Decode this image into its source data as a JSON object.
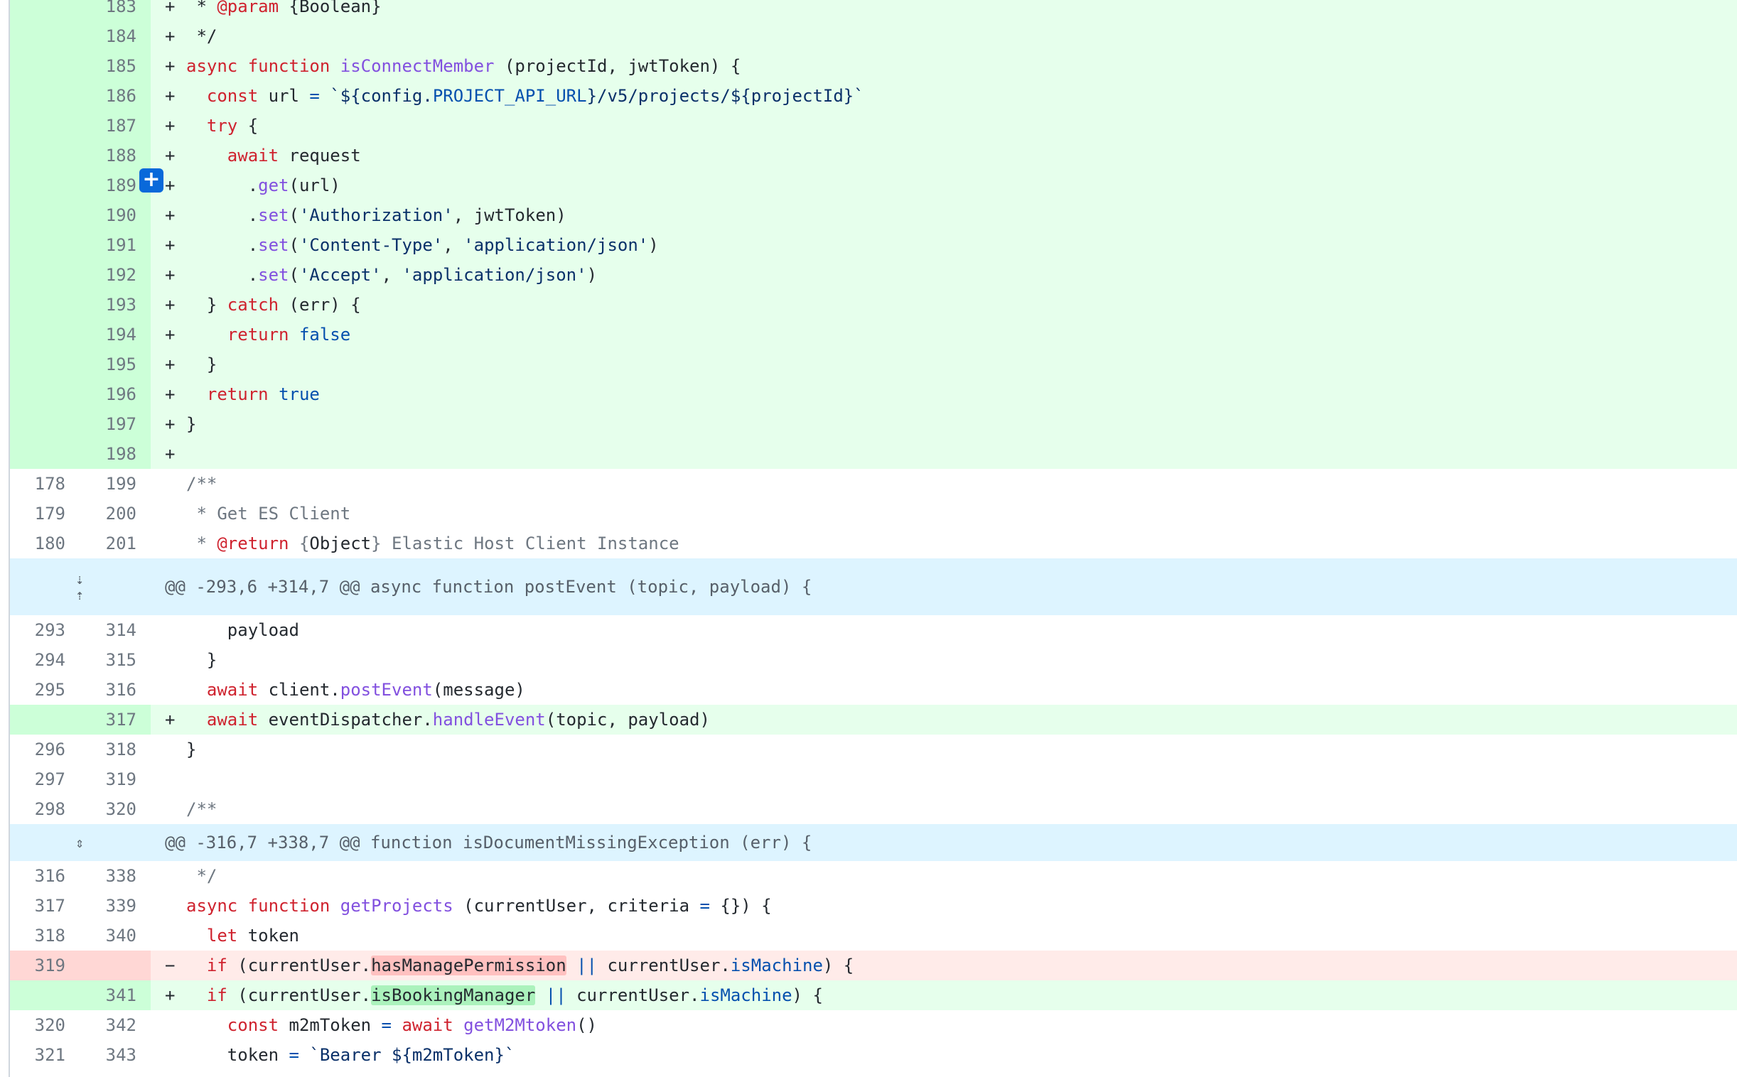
{
  "add_comment": {
    "label": "+"
  },
  "hunks": [
    {
      "header": "@@ -293,6 +314,7 @@ async function postEvent (topic, payload) {",
      "expand_up": "⇣",
      "expand_down": "⇡"
    },
    {
      "header": "@@ -316,7 +338,7 @@ function isDocumentMissingException (err) {",
      "expand_both": "⇕"
    }
  ],
  "lines": [
    {
      "old": "",
      "new": "183",
      "marker": "+",
      "type": "add"
    },
    {
      "old": "",
      "new": "184",
      "marker": "+",
      "type": "add"
    },
    {
      "old": "",
      "new": "185",
      "marker": "+",
      "type": "add"
    },
    {
      "old": "",
      "new": "186",
      "marker": "+",
      "type": "add"
    },
    {
      "old": "",
      "new": "187",
      "marker": "+",
      "type": "add"
    },
    {
      "old": "",
      "new": "188",
      "marker": "+",
      "type": "add"
    },
    {
      "old": "",
      "new": "189",
      "marker": "+",
      "type": "add"
    },
    {
      "old": "",
      "new": "190",
      "marker": "+",
      "type": "add"
    },
    {
      "old": "",
      "new": "191",
      "marker": "+",
      "type": "add"
    },
    {
      "old": "",
      "new": "192",
      "marker": "+",
      "type": "add"
    },
    {
      "old": "",
      "new": "193",
      "marker": "+",
      "type": "add"
    },
    {
      "old": "",
      "new": "194",
      "marker": "+",
      "type": "add"
    },
    {
      "old": "",
      "new": "195",
      "marker": "+",
      "type": "add"
    },
    {
      "old": "",
      "new": "196",
      "marker": "+",
      "type": "add"
    },
    {
      "old": "",
      "new": "197",
      "marker": "+",
      "type": "add"
    },
    {
      "old": "",
      "new": "198",
      "marker": "+",
      "type": "add"
    },
    {
      "old": "178",
      "new": "199",
      "marker": "",
      "type": "ctx"
    },
    {
      "old": "179",
      "new": "200",
      "marker": "",
      "type": "ctx"
    },
    {
      "old": "180",
      "new": "201",
      "marker": "",
      "type": "ctx"
    },
    {
      "old": "293",
      "new": "314",
      "marker": "",
      "type": "ctx"
    },
    {
      "old": "294",
      "new": "315",
      "marker": "",
      "type": "ctx"
    },
    {
      "old": "295",
      "new": "316",
      "marker": "",
      "type": "ctx"
    },
    {
      "old": "",
      "new": "317",
      "marker": "+",
      "type": "add"
    },
    {
      "old": "296",
      "new": "318",
      "marker": "",
      "type": "ctx"
    },
    {
      "old": "297",
      "new": "319",
      "marker": "",
      "type": "ctx"
    },
    {
      "old": "298",
      "new": "320",
      "marker": "",
      "type": "ctx"
    },
    {
      "old": "316",
      "new": "338",
      "marker": "",
      "type": "ctx"
    },
    {
      "old": "317",
      "new": "339",
      "marker": "",
      "type": "ctx"
    },
    {
      "old": "318",
      "new": "340",
      "marker": "",
      "type": "ctx"
    },
    {
      "old": "319",
      "new": "",
      "marker": "−",
      "type": "del"
    },
    {
      "old": "",
      "new": "341",
      "marker": "+",
      "type": "add"
    },
    {
      "old": "320",
      "new": "342",
      "marker": "",
      "type": "ctx"
    },
    {
      "old": "321",
      "new": "343",
      "marker": "",
      "type": "ctx"
    }
  ],
  "code": {
    "l183": {
      "a": " * ",
      "b": "@param",
      "c": " {Boolean}"
    },
    "l184": {
      "a": " */"
    },
    "l185": {
      "a": "async",
      "b": " ",
      "c": "function",
      "d": " ",
      "e": "isConnectMember",
      "f": " (projectId, jwtToken) {"
    },
    "l186": {
      "a": "  ",
      "b": "const",
      "c": " url ",
      "d": "=",
      "e": " `${config.",
      "f": "PROJECT_API_URL",
      "g": "}/v5/projects/${projectId}`"
    },
    "l187": {
      "a": "  ",
      "b": "try",
      "c": " {"
    },
    "l188": {
      "a": "    ",
      "b": "await",
      "c": " request"
    },
    "l189": {
      "a": "      .",
      "b": "get",
      "c": "(url)"
    },
    "l190": {
      "a": "      .",
      "b": "set",
      "c": "(",
      "d": "'Authorization'",
      "e": ", jwtToken)"
    },
    "l191": {
      "a": "      .",
      "b": "set",
      "c": "(",
      "d": "'Content-Type'",
      "e": ", ",
      "f": "'application/json'",
      "g": ")"
    },
    "l192": {
      "a": "      .",
      "b": "set",
      "c": "(",
      "d": "'Accept'",
      "e": ", ",
      "f": "'application/json'",
      "g": ")"
    },
    "l193": {
      "a": "  } ",
      "b": "catch",
      "c": " (err) {"
    },
    "l194": {
      "a": "    ",
      "b": "return",
      "c": " ",
      "d": "false"
    },
    "l195": {
      "a": "  }"
    },
    "l196": {
      "a": "  ",
      "b": "return",
      "c": " ",
      "d": "true"
    },
    "l197": {
      "a": "}"
    },
    "l198": {
      "a": ""
    },
    "l199": {
      "a": "/**"
    },
    "l200": {
      "a": " * Get ES Client"
    },
    "l201": {
      "a": " * ",
      "b": "@return",
      "c": " {",
      "d": "Object",
      "e": "} Elastic Host Client Instance"
    },
    "l314": {
      "a": "    payload"
    },
    "l315": {
      "a": "  }"
    },
    "l316": {
      "a": "  ",
      "b": "await",
      "c": " client.",
      "d": "postEvent",
      "e": "(message)"
    },
    "l317": {
      "a": "  ",
      "b": "await",
      "c": " eventDispatcher.",
      "d": "handleEvent",
      "e": "(topic, payload)"
    },
    "l318": {
      "a": "}"
    },
    "l319": {
      "a": ""
    },
    "l320": {
      "a": "/**"
    },
    "l338": {
      "a": " */"
    },
    "l339": {
      "a": "async",
      "b": " ",
      "c": "function",
      "d": " ",
      "e": "getProjects",
      "f": " (currentUser, criteria ",
      "g": "=",
      "h": " {}) {"
    },
    "l340": {
      "a": "  ",
      "b": "let",
      "c": " token"
    },
    "d319": {
      "a": "  ",
      "b": "if",
      "c": " (currentUser.",
      "d": "hasManagePermission",
      "e": " ",
      "f": "||",
      "g": " currentUser.",
      "h": "isMachine",
      "i": ") {"
    },
    "l341": {
      "a": "  ",
      "b": "if",
      "c": " (currentUser.",
      "d": "isBookingManager",
      "e": " ",
      "f": "||",
      "g": " currentUser.",
      "h": "isMachine",
      "i": ") {"
    },
    "l342": {
      "a": "    ",
      "b": "const",
      "c": " m2mToken ",
      "d": "=",
      "e": " ",
      "f": "await",
      "g": " ",
      "h": "getM2Mtoken",
      "i": "()"
    },
    "l343": {
      "a": "    token ",
      "b": "=",
      "c": " `Bearer ${m2mToken}`"
    }
  }
}
